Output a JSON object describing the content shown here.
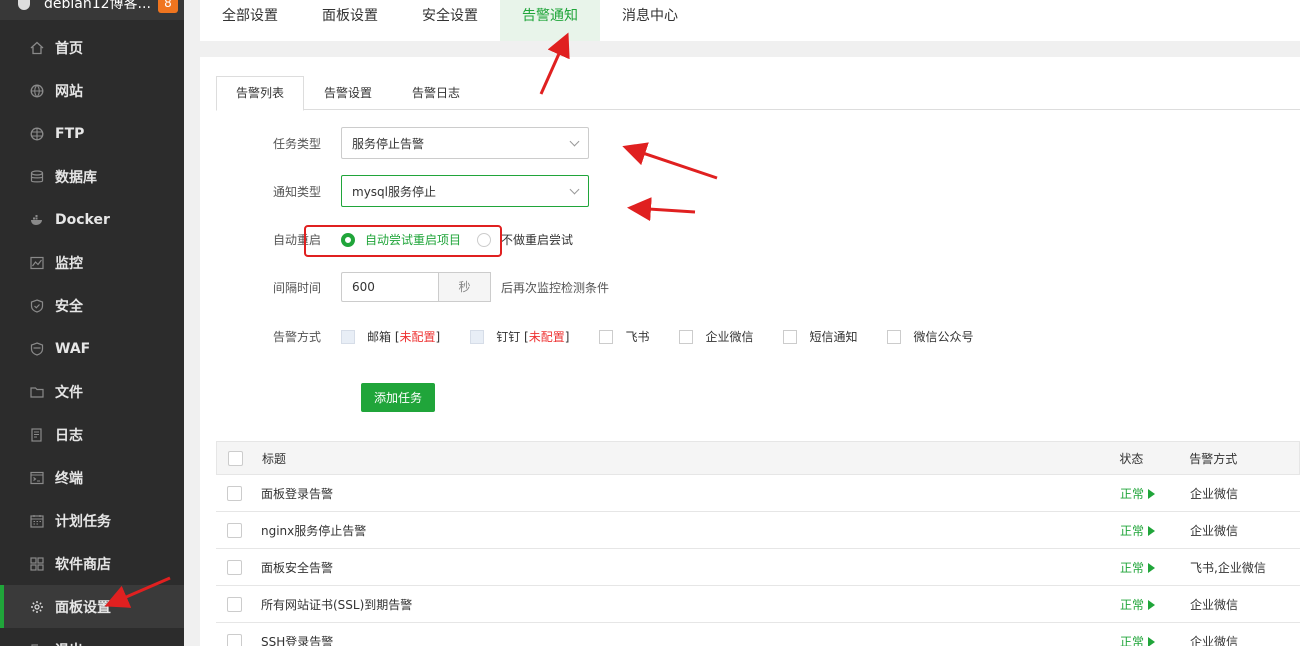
{
  "sidebar": {
    "host": "debian12博客...",
    "badge": "8",
    "items": [
      {
        "label": "首页",
        "icon": "home-icon"
      },
      {
        "label": "网站",
        "icon": "globe-icon"
      },
      {
        "label": "FTP",
        "icon": "ftp-globe-icon"
      },
      {
        "label": "数据库",
        "icon": "database-icon"
      },
      {
        "label": "Docker",
        "icon": "docker-icon"
      },
      {
        "label": "监控",
        "icon": "monitor-icon"
      },
      {
        "label": "安全",
        "icon": "shield-icon"
      },
      {
        "label": "WAF",
        "icon": "waf-shield-icon"
      },
      {
        "label": "文件",
        "icon": "folder-icon"
      },
      {
        "label": "日志",
        "icon": "log-icon"
      },
      {
        "label": "终端",
        "icon": "terminal-icon"
      },
      {
        "label": "计划任务",
        "icon": "calendar-icon"
      },
      {
        "label": "软件商店",
        "icon": "grid-icon"
      },
      {
        "label": "面板设置",
        "icon": "gear-icon"
      },
      {
        "label": "退出",
        "icon": "exit-icon"
      }
    ]
  },
  "topnav": {
    "tabs": [
      "全部设置",
      "面板设置",
      "安全设置",
      "告警通知",
      "消息中心"
    ],
    "active": "告警通知"
  },
  "subtabs": [
    "告警列表",
    "告警设置",
    "告警日志"
  ],
  "form": {
    "task_type_label": "任务类型",
    "task_type_value": "服务停止告警",
    "notify_type_label": "通知类型",
    "notify_type_value": "mysql服务停止",
    "auto_restart_label": "自动重启",
    "auto_restart_on": "自动尝试重启项目",
    "auto_restart_off": "不做重启尝试",
    "interval_label": "间隔时间",
    "interval_value": "600",
    "interval_unit": "秒",
    "interval_hint": "后再次监控检测条件",
    "method_label": "告警方式",
    "methods": [
      {
        "label": "邮箱",
        "note": "未配置"
      },
      {
        "label": "钉钉",
        "note": "未配置"
      },
      {
        "label": "飞书"
      },
      {
        "label": "企业微信"
      },
      {
        "label": "短信通知"
      },
      {
        "label": "微信公众号"
      }
    ],
    "add_button": "添加任务"
  },
  "table": {
    "headers": {
      "title": "标题",
      "status": "状态",
      "method": "告警方式"
    },
    "rows": [
      {
        "title": "面板登录告警",
        "status": "正常",
        "method": "企业微信"
      },
      {
        "title": "nginx服务停止告警",
        "status": "正常",
        "method": "企业微信"
      },
      {
        "title": "面板安全告警",
        "status": "正常",
        "method": "飞书,企业微信"
      },
      {
        "title": "所有网站证书(SSL)到期告警",
        "status": "正常",
        "method": "企业微信"
      },
      {
        "title": "SSH登录告警",
        "status": "正常",
        "method": "企业微信"
      }
    ]
  },
  "colors": {
    "accent": "#20a53a",
    "sidebar": "#2c2c2c",
    "annotation": "#e02020"
  }
}
